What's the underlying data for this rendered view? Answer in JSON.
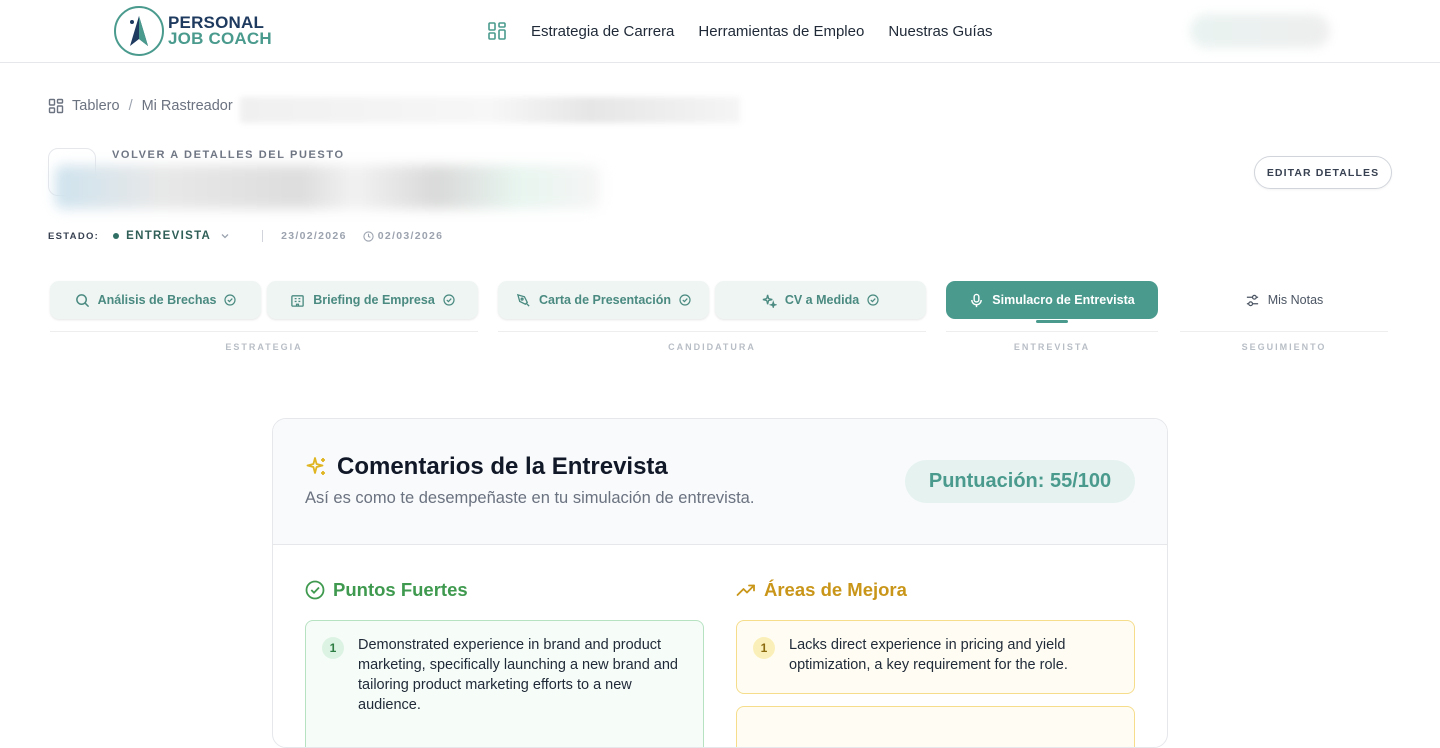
{
  "brand": {
    "line1": "PERSONAL",
    "line2": "JOB COACH"
  },
  "nav": {
    "items": [
      "Estrategia de Carrera",
      "Herramientas de Empleo",
      "Nuestras Guías"
    ]
  },
  "breadcrumb": {
    "home": "Tablero",
    "separator": "/",
    "current": "Mi Rastreador"
  },
  "job": {
    "back_link": "VOLVER A DETALLES DEL PUESTO",
    "edit_label": "EDITAR DETALLES"
  },
  "status": {
    "label": "ESTADO:",
    "value": "ENTREVISTA",
    "date_start": "23/02/2026",
    "date_end": "02/03/2026"
  },
  "tabs": [
    {
      "label": "Análisis de Brechas"
    },
    {
      "label": "Briefing de Empresa"
    },
    {
      "label": "Carta de Presentación"
    },
    {
      "label": "CV a Medida"
    },
    {
      "label": "Simulacro de Entrevista"
    },
    {
      "label": "Mis Notas"
    }
  ],
  "groups": [
    "ESTRATEGIA",
    "CANDIDATURA",
    "ENTREVISTA",
    "SEGUIMIENTO"
  ],
  "feedback": {
    "title": "Comentarios de la Entrevista",
    "subtitle": "Así es como te desempeñaste en tu simulación de entrevista.",
    "score": "Puntuación: 55/100",
    "strengths_title": "Puntos Fuertes",
    "improve_title": "Áreas de Mejora",
    "strengths": [
      {
        "num": "1",
        "text": "Demonstrated experience in brand and product marketing, specifically launching a new brand and tailoring product marketing efforts to a new audience."
      }
    ],
    "improvements": [
      {
        "num": "1",
        "text": "Lacks direct experience in pricing and yield optimization, a key requirement for the role."
      }
    ]
  },
  "colors": {
    "accent": "#4a9b8e",
    "navy": "#1e3a5f",
    "green": "#3f9a4f",
    "amber": "#c9961a"
  }
}
